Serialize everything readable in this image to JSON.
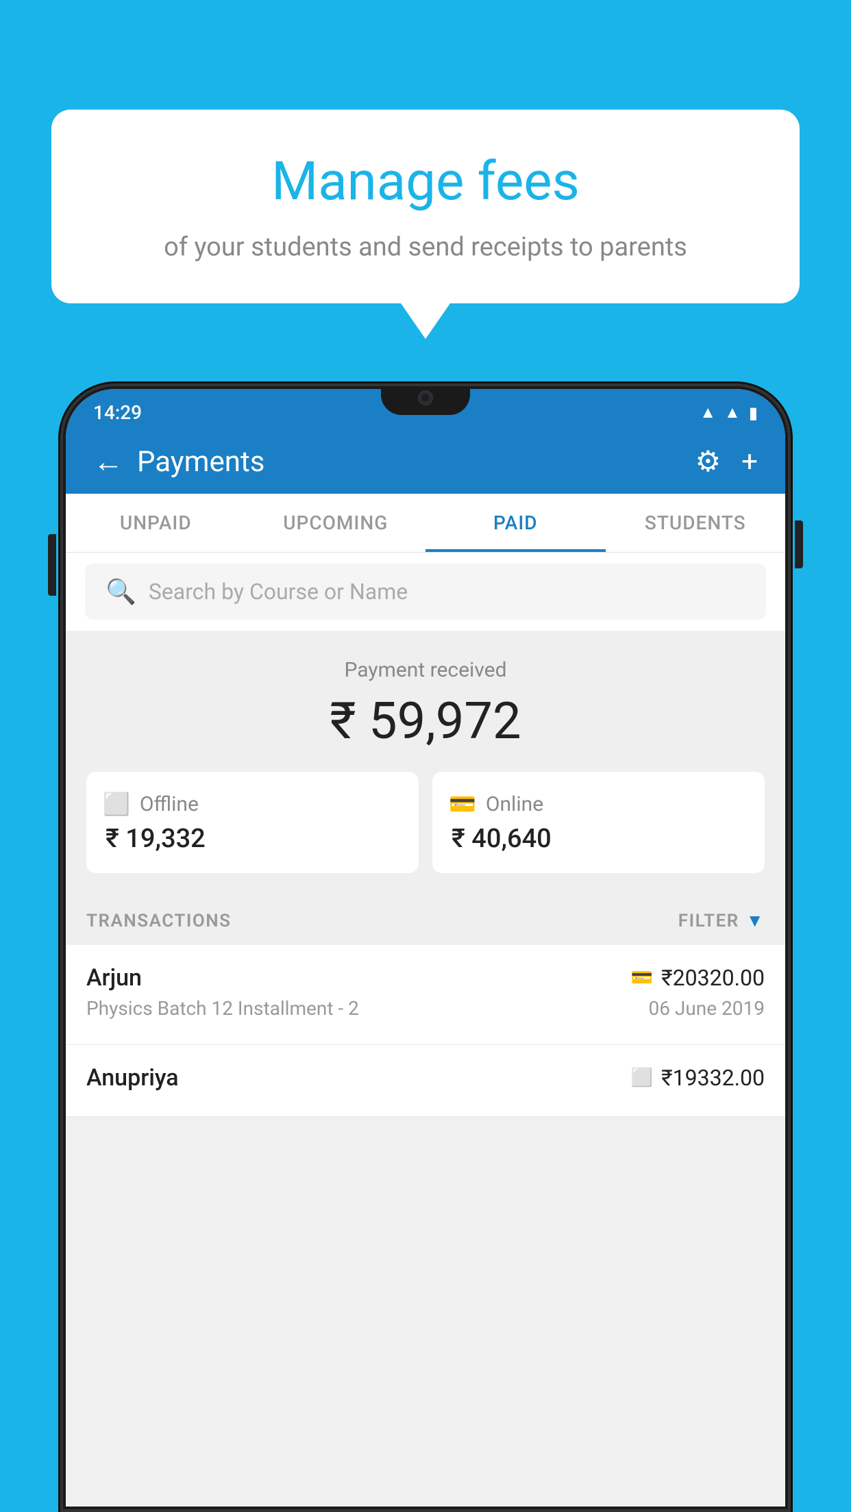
{
  "page": {
    "bg_color": "#1ab4e8"
  },
  "bubble": {
    "title": "Manage fees",
    "subtitle": "of your students and send receipts to parents"
  },
  "status_bar": {
    "time": "14:29",
    "icons": [
      "wifi",
      "signal",
      "battery"
    ]
  },
  "app_bar": {
    "title": "Payments",
    "back_label": "←",
    "settings_label": "⚙",
    "add_label": "+"
  },
  "tabs": [
    {
      "label": "UNPAID",
      "active": false
    },
    {
      "label": "UPCOMING",
      "active": false
    },
    {
      "label": "PAID",
      "active": true
    },
    {
      "label": "STUDENTS",
      "active": false
    }
  ],
  "search": {
    "placeholder": "Search by Course or Name"
  },
  "payment": {
    "label": "Payment received",
    "total": "₹ 59,972",
    "offline_label": "Offline",
    "offline_amount": "₹ 19,332",
    "online_label": "Online",
    "online_amount": "₹ 40,640"
  },
  "transactions": {
    "header": "TRANSACTIONS",
    "filter_label": "FILTER",
    "items": [
      {
        "name": "Arjun",
        "detail": "Physics Batch 12 Installment - 2",
        "date": "06 June 2019",
        "amount": "₹20320.00",
        "method": "card"
      },
      {
        "name": "Anupriya",
        "detail": "",
        "date": "",
        "amount": "₹19332.00",
        "method": "cash"
      }
    ]
  }
}
